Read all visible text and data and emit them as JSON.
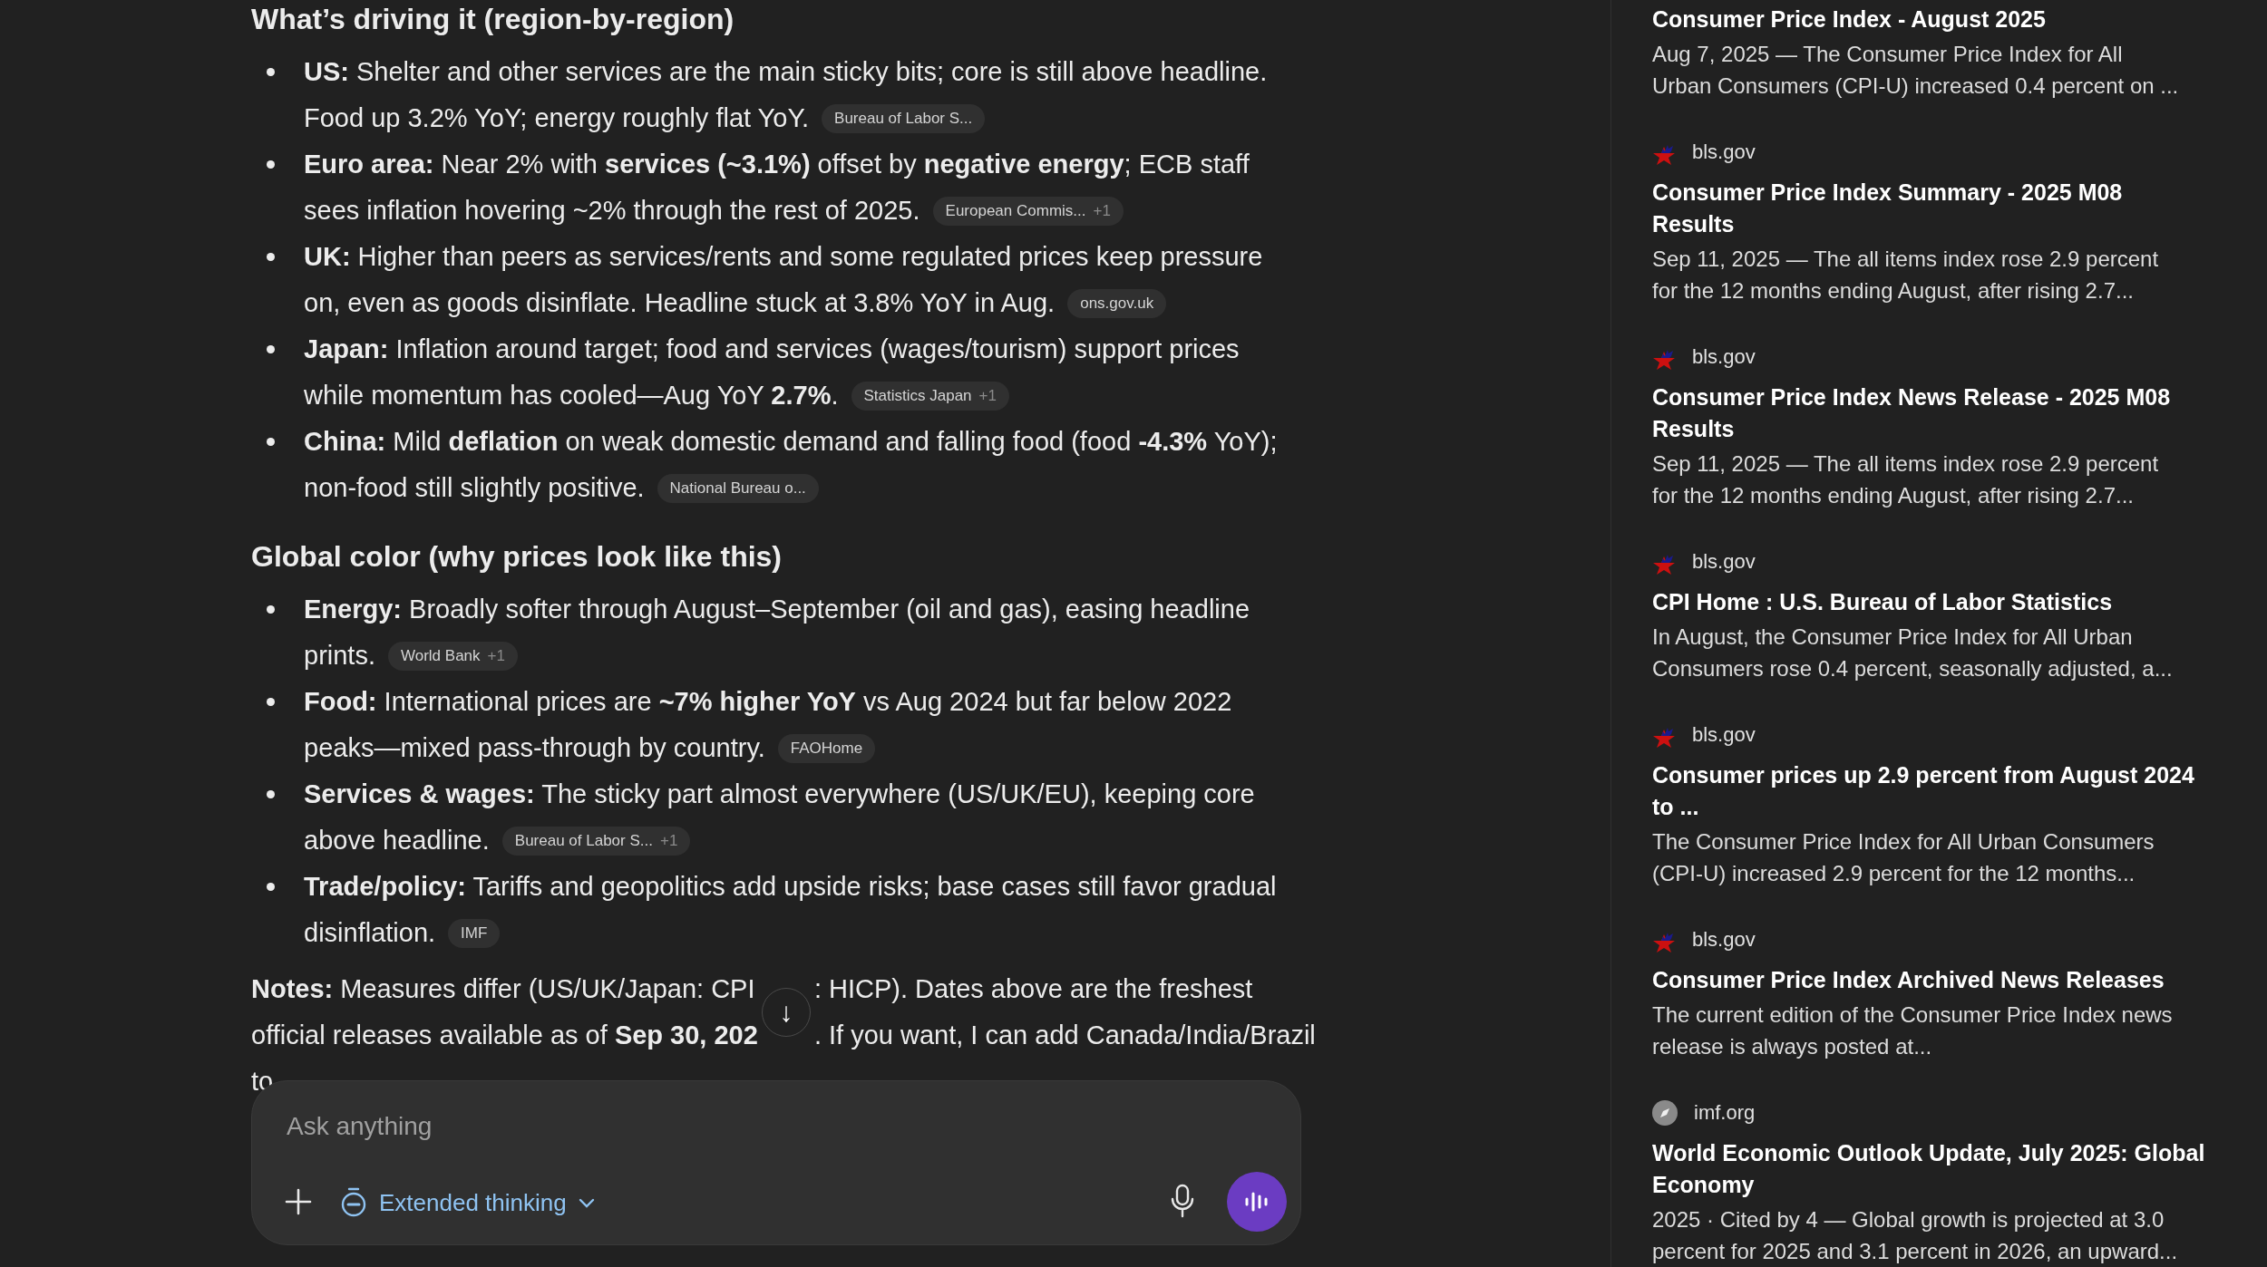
{
  "sections": [
    {
      "heading": "What’s driving it (region-by-region)",
      "items": [
        {
          "lines": [
            "**US:** Shelter and other services are the main sticky bits; core is still above headline.",
            "Food up 3.2% YoY; energy roughly flat YoY."
          ],
          "chip": {
            "label": "Bureau of Labor S..."
          }
        },
        {
          "lines": [
            "**Euro area:** Near 2% with **services (~3.1%)** offset by **negative energy**; ECB staff",
            "sees inflation hovering ~2% through the rest of 2025."
          ],
          "chip": {
            "label": "European Commis...",
            "extra": "+1"
          }
        },
        {
          "lines": [
            "**UK:** Higher than peers as services/rents and some regulated prices keep pressure",
            "on, even as goods disinflate. Headline stuck at 3.8% YoY in Aug."
          ],
          "chip": {
            "label": "ons.gov.uk"
          }
        },
        {
          "lines": [
            "**Japan:** Inflation around target; food and services (wages/tourism) support prices",
            "while momentum has cooled—Aug YoY **2.7%**."
          ],
          "chip": {
            "label": "Statistics Japan",
            "extra": "+1"
          }
        },
        {
          "lines": [
            "**China:** Mild **deflation** on weak domestic demand and falling food (food **-4.3%** YoY);",
            "non-food still slightly positive."
          ],
          "chip": {
            "label": "National Bureau o..."
          }
        }
      ]
    },
    {
      "heading": "Global color (why prices look like this)",
      "items": [
        {
          "lines": [
            "**Energy:** Broadly softer through August–September (oil and gas), easing headline",
            "prints."
          ],
          "chip": {
            "label": "World Bank",
            "extra": "+1"
          }
        },
        {
          "lines": [
            "**Food:** International prices are **~7% higher YoY** vs Aug 2024 but far below 2022",
            "peaks—mixed pass-through by country."
          ],
          "chip": {
            "label": "FAOHome"
          }
        },
        {
          "lines": [
            "**Services & wages:** The sticky part almost everywhere (US/UK/EU), keeping core",
            "above headline."
          ],
          "chip": {
            "label": "Bureau of Labor S...",
            "extra": "+1"
          }
        },
        {
          "lines": [
            "**Trade/policy:** Tariffs and geopolitics add upside risks; base cases still favor gradual",
            "disinflation."
          ],
          "chip": {
            "label": "IMF"
          }
        }
      ]
    }
  ],
  "notes": {
    "lines": [
      [
        "**Notes:** Measures differ (US/UK/Japan: CPI",
        ": HICP). Dates above are the freshest"
      ],
      [
        "official releases available as of **Sep 30, 202**",
        ". If you want, I can add Canada/India/Brazil"
      ],
      [
        "to"
      ]
    ]
  },
  "scroll_down": {
    "glyph": "↓"
  },
  "composer": {
    "placeholder": "Ask anything",
    "mode": "Extended thinking"
  },
  "sources": [
    {
      "title": [
        "Consumer Price Index - August 2025"
      ],
      "snippet": [
        "Aug 7, 2025 — The Consumer Price Index for All",
        "Urban Consumers (CPI-U) increased 0.4 percent on ..."
      ]
    },
    {
      "site": "bls.gov",
      "kind": "star",
      "title": [
        "Consumer Price Index Summary - 2025 M08",
        "Results"
      ],
      "snippet": [
        "Sep 11, 2025 — The all items index rose 2.9 percent",
        "for the 12 months ending August, after rising 2.7..."
      ]
    },
    {
      "site": "bls.gov",
      "kind": "star",
      "title": [
        "Consumer Price Index News Release - 2025 M08",
        "Results"
      ],
      "snippet": [
        "Sep 11, 2025 — The all items index rose 2.9 percent",
        "for the 12 months ending August, after rising 2.7..."
      ]
    },
    {
      "site": "bls.gov",
      "kind": "star",
      "title": [
        "CPI Home : U.S. Bureau of Labor Statistics"
      ],
      "snippet": [
        "In August, the Consumer Price Index for All Urban",
        "Consumers rose 0.4 percent, seasonally adjusted, a..."
      ]
    },
    {
      "site": "bls.gov",
      "kind": "star",
      "title": [
        "Consumer prices up 2.9 percent from August 2024",
        "to ..."
      ],
      "snippet": [
        "The Consumer Price Index for All Urban Consumers",
        "(CPI-U) increased 2.9 percent for the 12 months..."
      ]
    },
    {
      "site": "bls.gov",
      "kind": "star",
      "title": [
        "Consumer Price Index Archived News Releases"
      ],
      "snippet": [
        "The current edition of the Consumer Price Index news",
        "release is always posted at..."
      ]
    },
    {
      "site": "imf.org",
      "kind": "compass",
      "title": [
        "World Economic Outlook Update, July 2025: Global",
        "Economy"
      ],
      "snippet": [
        "2025 · Cited by 4 — Global growth is projected at 3.0",
        "percent for 2025 and 3.1 percent in 2026, an upward..."
      ]
    }
  ]
}
